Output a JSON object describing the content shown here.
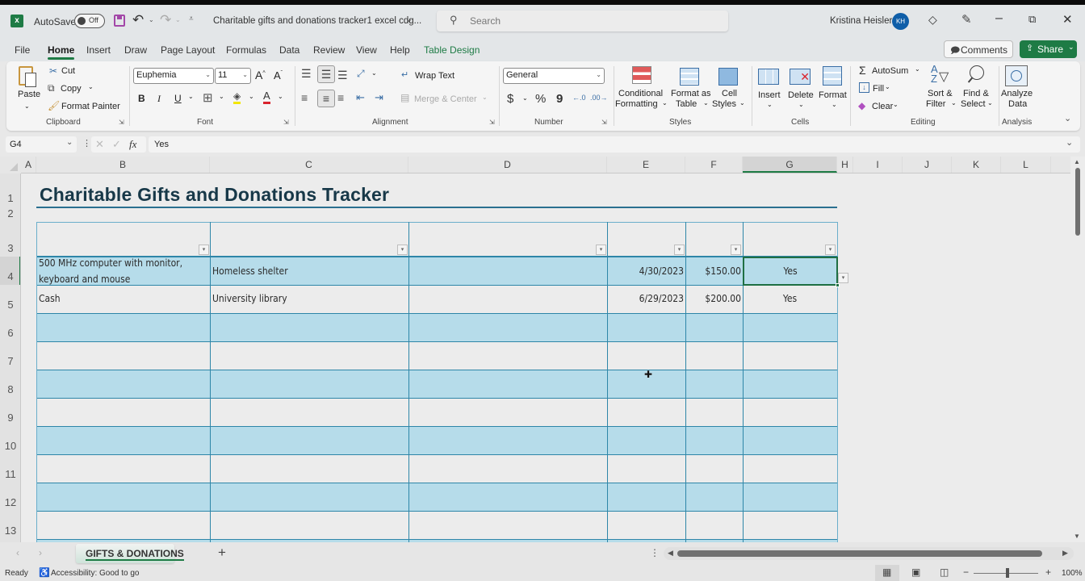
{
  "titlebar": {
    "autosave_label": "AutoSave",
    "autosave_state": "Off",
    "doc_title": "Charitable gifts and donations tracker1 excel cdg...",
    "search_placeholder": "Search",
    "user_name": "Kristina Heisler",
    "user_initials": "KH"
  },
  "menu_tabs": [
    "File",
    "Home",
    "Insert",
    "Draw",
    "Page Layout",
    "Formulas",
    "Data",
    "Review",
    "View",
    "Help",
    "Table Design"
  ],
  "active_tab": "Home",
  "buttons": {
    "comments": "Comments",
    "share": "Share"
  },
  "ribbon": {
    "clipboard": {
      "paste": "Paste",
      "cut": "Cut",
      "copy": "Copy",
      "format_painter": "Format Painter",
      "group": "Clipboard"
    },
    "font": {
      "name": "Euphemia",
      "size": "11",
      "group": "Font",
      "bold": "B",
      "italic": "I",
      "underline": "U"
    },
    "alignment": {
      "wrap_text": "Wrap Text",
      "merge_center": "Merge & Center",
      "group": "Alignment"
    },
    "number": {
      "format": "General",
      "currency": "$",
      "percent": "%",
      "comma": "9",
      "group": "Number"
    },
    "styles": {
      "conditional_1": "Conditional",
      "conditional_2": "Formatting",
      "format_table_1": "Format as",
      "format_table_2": "Table",
      "cell_styles_1": "Cell",
      "cell_styles_2": "Styles",
      "group": "Styles"
    },
    "cells": {
      "insert": "Insert",
      "delete": "Delete",
      "format": "Format",
      "group": "Cells"
    },
    "editing": {
      "autosum": "AutoSum",
      "fill": "Fill",
      "clear": "Clear",
      "sort_1": "Sort &",
      "sort_2": "Filter",
      "find_1": "Find &",
      "find_2": "Select",
      "group": "Editing"
    },
    "analysis": {
      "analyze_1": "Analyze",
      "analyze_2": "Data",
      "group": "Analysis"
    }
  },
  "formula_bar": {
    "name_box": "G4",
    "fx": "fx",
    "content": "Yes"
  },
  "columns": [
    "A",
    "B",
    "C",
    "D",
    "E",
    "F",
    "G",
    "H",
    "I",
    "J",
    "K",
    "L"
  ],
  "selected_column": "G",
  "rows": [
    "1",
    "2",
    "3",
    "4",
    "5",
    "6",
    "7",
    "8",
    "9",
    "10",
    "11",
    "12",
    "13"
  ],
  "sheet": {
    "title": "Charitable Gifts and Donations Tracker",
    "table_rows": [
      {
        "b_line1": "500 MHz computer with monitor,",
        "b_line2": "keyboard and mouse",
        "c": "Homeless shelter",
        "d": "",
        "e": "4/30/2023",
        "f": "$150.00",
        "g": "Yes"
      },
      {
        "b_line1": "Cash",
        "b_line2": "",
        "c": "University library",
        "d": "",
        "e": "6/29/2023",
        "f": "$200.00",
        "g": "Yes"
      }
    ],
    "selected_cell": "G4"
  },
  "sheet_tabs": {
    "active": "GIFTS & DONATIONS",
    "add": "+"
  },
  "status": {
    "ready": "Ready",
    "accessibility": "Accessibility: Good to go",
    "zoom": "100%",
    "zoom_minus": "−",
    "zoom_plus": "+"
  },
  "colors": {
    "excel_green": "#1e7b45",
    "band_blue": "#b6dcea",
    "table_border": "#2e86a8",
    "title_color": "#173848",
    "avatar": "#0f5ea8"
  }
}
